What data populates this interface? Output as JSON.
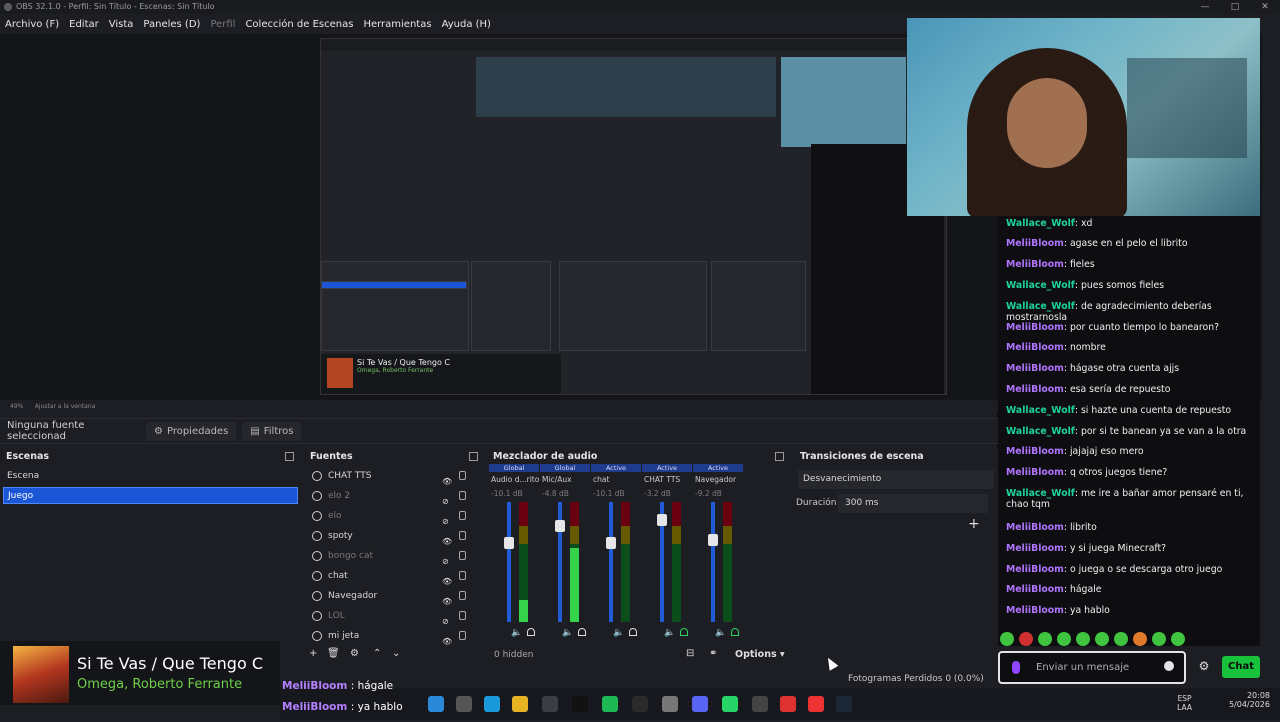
{
  "window": {
    "title": "OBS 32.1.0 - Perfil: Sin Título - Escenas: Sin Título",
    "controls": [
      "—",
      "□",
      "✕"
    ]
  },
  "menu": [
    {
      "label": "Archivo (F)",
      "dim": false
    },
    {
      "label": "Editar",
      "dim": false
    },
    {
      "label": "Vista",
      "dim": false
    },
    {
      "label": "Paneles (D)",
      "dim": false
    },
    {
      "label": "Perfil",
      "dim": true
    },
    {
      "label": "Colección de Escenas",
      "dim": false
    },
    {
      "label": "Herramientas",
      "dim": false
    },
    {
      "label": "Ayuda (H)",
      "dim": false
    }
  ],
  "zoom": {
    "percent": "49%",
    "fit": "Ajustar a la ventana"
  },
  "properties_bar": {
    "no_source": "Ninguna fuente seleccionad",
    "properties_label": "Propiedades",
    "filters_label": "Filtros"
  },
  "scenes": {
    "title": "Escenas",
    "items": [
      {
        "label": "Escena",
        "selected": false
      },
      {
        "label": "Juego",
        "selected": true
      }
    ]
  },
  "sources": {
    "title": "Fuentes",
    "items": [
      {
        "label": "CHAT TTS",
        "visible": true,
        "icon": "globe-icon"
      },
      {
        "label": "elo 2",
        "visible": false,
        "icon": "globe-icon"
      },
      {
        "label": "elo",
        "visible": false,
        "icon": "globe-icon"
      },
      {
        "label": "spoty",
        "visible": true,
        "icon": "globe-icon"
      },
      {
        "label": "bongo cat",
        "visible": false,
        "icon": "window-icon"
      },
      {
        "label": "chat",
        "visible": true,
        "icon": "globe-icon"
      },
      {
        "label": "Navegador",
        "visible": true,
        "icon": "globe-icon"
      },
      {
        "label": "LOL",
        "visible": false,
        "icon": "link-icon"
      },
      {
        "label": "mi jeta",
        "visible": true,
        "icon": "camera-icon"
      }
    ]
  },
  "mixer": {
    "title": "Mezclador de audio",
    "channels": [
      {
        "badge": "Global",
        "name": "Audio d...ritorio",
        "db": "-10.1 dB",
        "level": 0.18,
        "fader": 0.66,
        "monitor_on": false
      },
      {
        "badge": "Global",
        "name": "Mic/Aux",
        "db": "-4.8 dB",
        "level": 0.62,
        "fader": 0.8,
        "monitor_on": false
      },
      {
        "badge": "Active",
        "name": "chat",
        "db": "-10.1 dB",
        "level": 0.0,
        "fader": 0.66,
        "monitor_on": false
      },
      {
        "badge": "Active",
        "name": "CHAT TTS",
        "db": "-3.2 dB",
        "level": 0.0,
        "fader": 0.85,
        "monitor_on": true
      },
      {
        "badge": "Active",
        "name": "Navegador",
        "db": "-9.2 dB",
        "level": 0.0,
        "fader": 0.68,
        "monitor_on": true
      }
    ],
    "scale": [
      "0",
      "-6",
      "-12",
      "-18",
      "-24",
      "-30",
      "-36",
      "-42",
      "-48",
      "-54",
      "-60"
    ],
    "hidden": "0 hidden",
    "options": "Options"
  },
  "transitions": {
    "title": "Transiciones de escena",
    "current": "Desvanecimiento",
    "duration_label": "Duración",
    "duration_value": "300 ms"
  },
  "chat": {
    "messages": [
      {
        "user": "Wallace_Wolf",
        "text": "xd"
      },
      {
        "user": "MeliiBloom",
        "text": "agase en el pelo el librito"
      },
      {
        "user": "MeliiBloom",
        "text": "fieles"
      },
      {
        "user": "Wallace_Wolf",
        "text": "pues somos fieles"
      },
      {
        "user": "Wallace_Wolf",
        "text": "de agradecimiento deberías mostrarnosla"
      },
      {
        "user": "MeliiBloom",
        "text": "por cuanto tiempo lo banearon?"
      },
      {
        "user": "MeliiBloom",
        "text": "nombre"
      },
      {
        "user": "MeliiBloom",
        "text": "hágase otra cuenta ajjs"
      },
      {
        "user": "MeliiBloom",
        "text": "esa sería de repuesto"
      },
      {
        "user": "Wallace_Wolf",
        "text": "si hazte una cuenta de repuesto"
      },
      {
        "user": "Wallace_Wolf",
        "text": "por si te banean ya se van a la otra"
      },
      {
        "user": "MeliiBloom",
        "text": "jajajaj eso mero"
      },
      {
        "user": "MeliiBloom",
        "text": "q otros juegos tiene?"
      },
      {
        "user": "Wallace_Wolf",
        "text": "me ire a bañar amor pensaré en ti, chao tqm"
      },
      {
        "user": "MeliiBloom",
        "text": "librito"
      },
      {
        "user": "MeliiBloom",
        "text": "y si juega Minecraft?"
      },
      {
        "user": "MeliiBloom",
        "text": "o juega o se descarga otro juego"
      },
      {
        "user": "MeliiBloom",
        "text": "hágale"
      },
      {
        "user": "MeliiBloom",
        "text": "ya hablo"
      }
    ],
    "input_placeholder": "Enviar un mensaje",
    "send_label": "Chat"
  },
  "now_playing": {
    "title": "Si Te Vas / Que Tengo C",
    "artist": "Omega, Roberto Ferrante"
  },
  "overlay_chat": [
    {
      "user": "MeliiBloom",
      "text": ": hágale"
    },
    {
      "user": "MeliiBloom",
      "text": ": ya hablo"
    }
  ],
  "status": {
    "dropped_frames": "Fotogramas Perdidos 0 (0.0%)"
  },
  "tray": {
    "lang_top": "ESP",
    "lang_bottom": "LAA",
    "time": "20:08",
    "date": "5/04/2026"
  },
  "colors": {
    "accent_blue": "#1a56d6",
    "twitch_purple": "#9147ff",
    "chat_green": "#18c23b",
    "user_m": "#b075ff",
    "user_w": "#1ed3a0"
  }
}
